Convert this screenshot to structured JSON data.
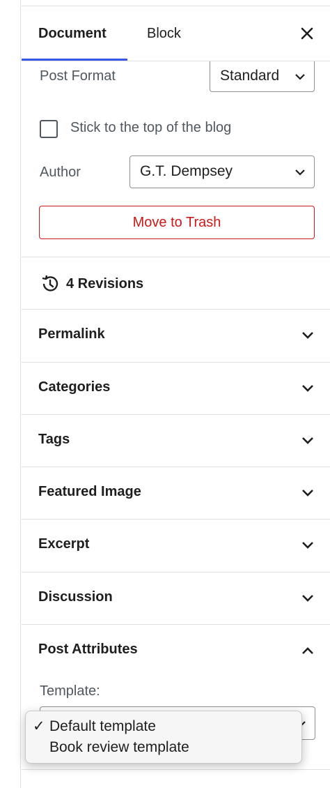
{
  "tabs": {
    "document": "Document",
    "block": "Block"
  },
  "post_format": {
    "label": "Post Format",
    "value": "Standard"
  },
  "sticky": {
    "label": "Stick to the top of the blog",
    "checked": false
  },
  "author": {
    "label": "Author",
    "value": "G.T. Dempsey"
  },
  "trash": {
    "label": "Move to Trash"
  },
  "revisions": {
    "label": "4 Revisions"
  },
  "sections": [
    {
      "title": "Permalink",
      "expanded": false
    },
    {
      "title": "Categories",
      "expanded": false
    },
    {
      "title": "Tags",
      "expanded": false
    },
    {
      "title": "Featured Image",
      "expanded": false
    },
    {
      "title": "Excerpt",
      "expanded": false
    },
    {
      "title": "Discussion",
      "expanded": false
    },
    {
      "title": "Post Attributes",
      "expanded": true
    }
  ],
  "template": {
    "label": "Template:",
    "options": [
      "Default template",
      "Book review template"
    ],
    "selected": "Default template",
    "check_glyph": "✓"
  },
  "colors": {
    "accent": "#3858e9",
    "danger": "#cc1818",
    "border": "#e0e0e0"
  }
}
